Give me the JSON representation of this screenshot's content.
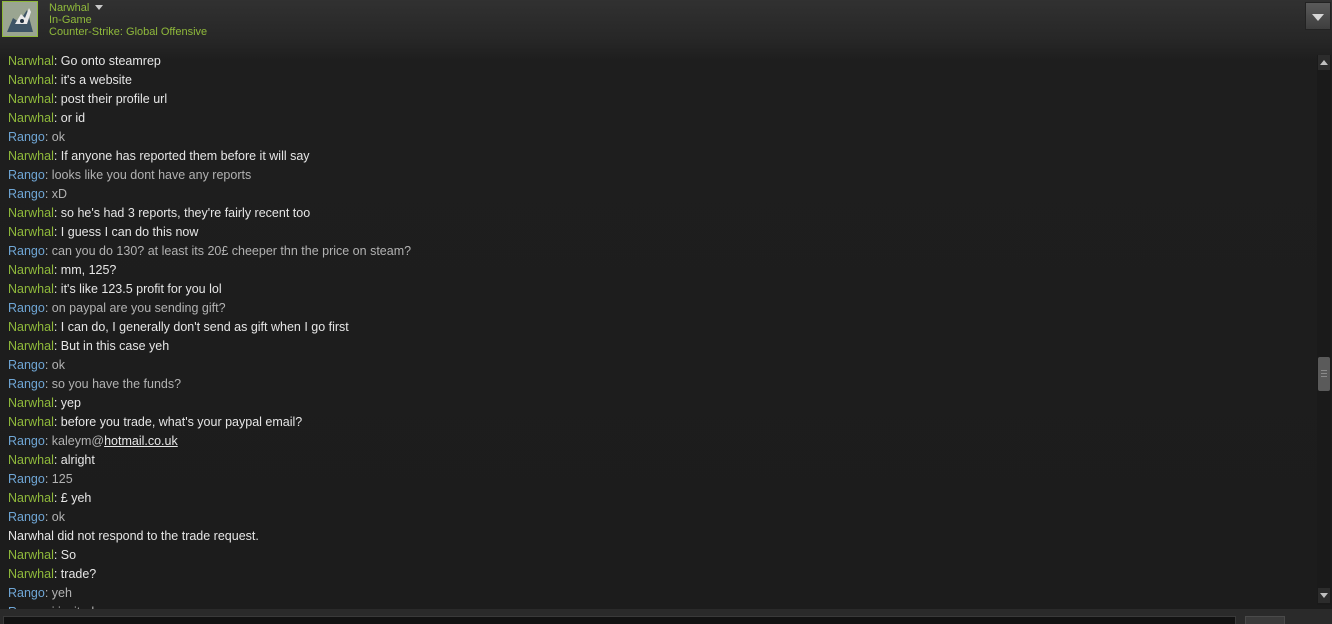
{
  "header": {
    "friend_name": "Narwhal",
    "status": "In-Game",
    "game": "Counter-Strike: Global Offensive"
  },
  "colors": {
    "narwhal": "#8fb93b",
    "rango": "#6fa6d5",
    "background": "#1c1c1c"
  },
  "messages": [
    {
      "speaker": "Narwhal",
      "text": ": Go onto steamrep"
    },
    {
      "speaker": "Narwhal",
      "text": ": it's a website"
    },
    {
      "speaker": "Narwhal",
      "text": ": post their profile url"
    },
    {
      "speaker": "Narwhal",
      "text": ": or id"
    },
    {
      "speaker": "Rango",
      "text": ": ok"
    },
    {
      "speaker": "Narwhal",
      "text": ": If anyone has reported them before it will say"
    },
    {
      "speaker": "Rango",
      "text": ": looks like you dont have any reports"
    },
    {
      "speaker": "Rango",
      "text": ": xD"
    },
    {
      "speaker": "Narwhal",
      "text": ": so he's had 3 reports, they're fairly recent too"
    },
    {
      "speaker": "Narwhal",
      "text": ": I guess I can do this now"
    },
    {
      "speaker": "Rango",
      "text": ": can you do 130? at least its 20£ cheeper thn the price on steam?"
    },
    {
      "speaker": "Narwhal",
      "text": ": mm, 125?"
    },
    {
      "speaker": "Narwhal",
      "text": ": it's like 123.5 profit for you lol"
    },
    {
      "speaker": "Rango",
      "text": ": on paypal are you sending gift?"
    },
    {
      "speaker": "Narwhal",
      "text": ": I can do, I generally don't send as gift when I go first"
    },
    {
      "speaker": "Narwhal",
      "text": ": But in this case yeh"
    },
    {
      "speaker": "Rango",
      "text": ": ok"
    },
    {
      "speaker": "Rango",
      "text": ": so you have the funds?"
    },
    {
      "speaker": "Narwhal",
      "text": ": yep"
    },
    {
      "speaker": "Narwhal",
      "text": ": before you trade, what's your paypal email?"
    },
    {
      "speaker": "Rango",
      "text": ": kaleym@",
      "link": "hotmail.co.uk"
    },
    {
      "speaker": "Narwhal",
      "text": ": alright"
    },
    {
      "speaker": "Rango",
      "text": ": 125"
    },
    {
      "speaker": "Narwhal",
      "text": ": £ yeh"
    },
    {
      "speaker": "Rango",
      "text": ": ok"
    },
    {
      "speaker": "",
      "text": "Narwhal did not respond to the trade request."
    },
    {
      "speaker": "Narwhal",
      "text": ": So"
    },
    {
      "speaker": "Narwhal",
      "text": ": trade?"
    },
    {
      "speaker": "Rango",
      "text": ": yeh"
    },
    {
      "speaker": "Rango",
      "text": ": i invited"
    }
  ]
}
